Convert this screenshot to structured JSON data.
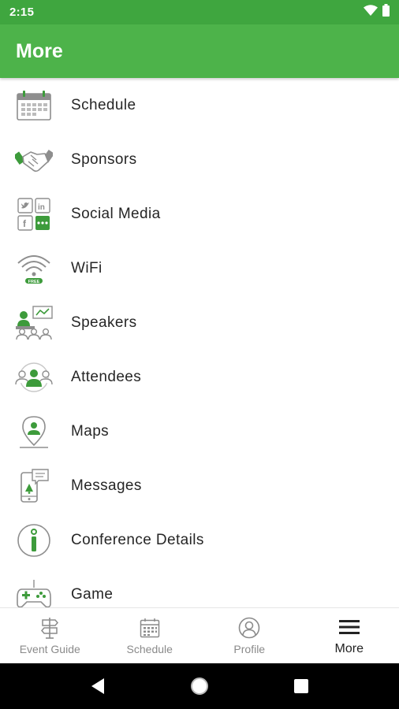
{
  "status_bar": {
    "time": "2:15"
  },
  "app_bar": {
    "title": "More"
  },
  "menu": {
    "items": [
      {
        "label": "Schedule",
        "icon": "calendar-icon"
      },
      {
        "label": "Sponsors",
        "icon": "handshake-icon"
      },
      {
        "label": "Social Media",
        "icon": "social-media-icon"
      },
      {
        "label": "WiFi",
        "icon": "wifi-icon"
      },
      {
        "label": "Speakers",
        "icon": "speakers-icon"
      },
      {
        "label": "Attendees",
        "icon": "attendees-icon"
      },
      {
        "label": "Maps",
        "icon": "map-pin-icon"
      },
      {
        "label": "Messages",
        "icon": "messages-icon"
      },
      {
        "label": "Conference Details",
        "icon": "info-icon"
      },
      {
        "label": "Game",
        "icon": "game-controller-icon"
      }
    ]
  },
  "bottom_nav": {
    "tabs": [
      {
        "label": "Event Guide",
        "icon": "signpost-icon"
      },
      {
        "label": "Schedule",
        "icon": "calendar-icon"
      },
      {
        "label": "Profile",
        "icon": "profile-icon"
      },
      {
        "label": "More",
        "icon": "hamburger-menu-icon"
      }
    ],
    "active": "More"
  },
  "colors": {
    "status_bar": "#3fa63f",
    "app_bar": "#4db34a",
    "icon_green": "#3d9b3b",
    "icon_gray": "#8e8e8e"
  }
}
